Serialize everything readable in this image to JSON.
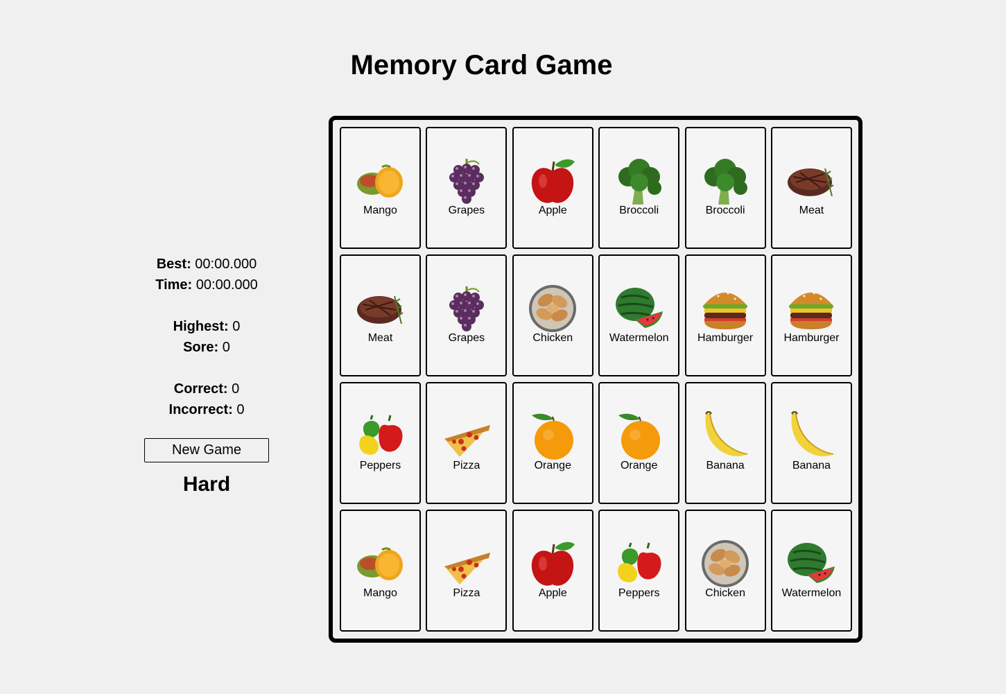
{
  "title": "Memory Card Game",
  "stats": {
    "best_label": "Best:",
    "best_value": "00:00.000",
    "time_label": "Time:",
    "time_value": "00:00.000",
    "highest_label": "Highest:",
    "highest_value": "0",
    "score_label": "Sore:",
    "score_value": "0",
    "correct_label": "Correct:",
    "correct_value": "0",
    "incorrect_label": "Incorrect:",
    "incorrect_value": "0"
  },
  "new_game_label": "New Game",
  "difficulty": "Hard",
  "cards": [
    {
      "label": "Mango",
      "icon": "mango-icon"
    },
    {
      "label": "Grapes",
      "icon": "grapes-icon"
    },
    {
      "label": "Apple",
      "icon": "apple-icon"
    },
    {
      "label": "Broccoli",
      "icon": "broccoli-icon"
    },
    {
      "label": "Broccoli",
      "icon": "broccoli-icon"
    },
    {
      "label": "Meat",
      "icon": "meat-icon"
    },
    {
      "label": "Meat",
      "icon": "meat-icon"
    },
    {
      "label": "Grapes",
      "icon": "grapes-icon"
    },
    {
      "label": "Chicken",
      "icon": "chicken-icon"
    },
    {
      "label": "Watermelon",
      "icon": "watermelon-icon"
    },
    {
      "label": "Hamburger",
      "icon": "hamburger-icon"
    },
    {
      "label": "Hamburger",
      "icon": "hamburger-icon"
    },
    {
      "label": "Peppers",
      "icon": "peppers-icon"
    },
    {
      "label": "Pizza",
      "icon": "pizza-icon"
    },
    {
      "label": "Orange",
      "icon": "orange-icon"
    },
    {
      "label": "Orange",
      "icon": "orange-icon"
    },
    {
      "label": "Banana",
      "icon": "banana-icon"
    },
    {
      "label": "Banana",
      "icon": "banana-icon"
    },
    {
      "label": "Mango",
      "icon": "mango-icon"
    },
    {
      "label": "Pizza",
      "icon": "pizza-icon"
    },
    {
      "label": "Apple",
      "icon": "apple-icon"
    },
    {
      "label": "Peppers",
      "icon": "peppers-icon"
    },
    {
      "label": "Chicken",
      "icon": "chicken-icon"
    },
    {
      "label": "Watermelon",
      "icon": "watermelon-icon"
    }
  ]
}
